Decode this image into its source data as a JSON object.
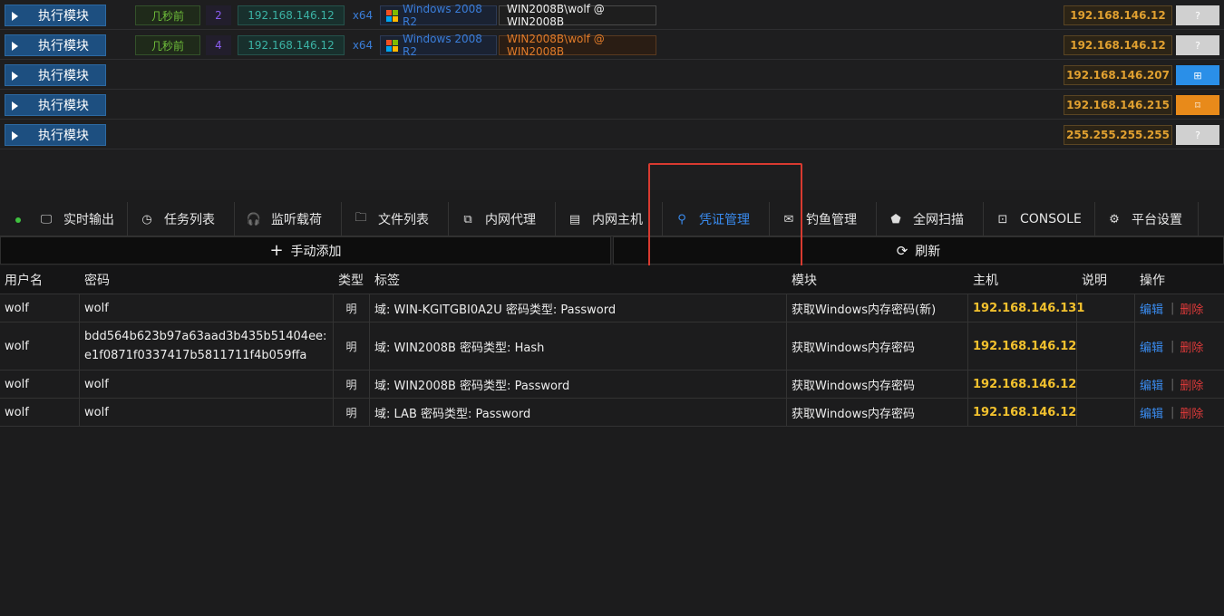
{
  "sessions": [
    {
      "exec": "执行模块",
      "time": "几秒前",
      "num": "2",
      "ip": "192.168.146.12",
      "arch": "x64",
      "os": "Windows 2008 R2",
      "user": "WIN2008B\\wolf @ WIN2008B",
      "user_style": "normal",
      "host_ip": "192.168.146.12",
      "icon": "?",
      "icon_style": "gray",
      "has_details": true
    },
    {
      "exec": "执行模块",
      "time": "几秒前",
      "num": "4",
      "ip": "192.168.146.12",
      "arch": "x64",
      "os": "Windows 2008 R2",
      "user": "WIN2008B\\wolf @ WIN2008B",
      "user_style": "orange",
      "host_ip": "192.168.146.12",
      "icon": "?",
      "icon_style": "gray",
      "has_details": true
    },
    {
      "exec": "执行模块",
      "host_ip": "192.168.146.207",
      "icon": "⊞",
      "icon_style": "blue",
      "has_details": false
    },
    {
      "exec": "执行模块",
      "host_ip": "192.168.146.215",
      "icon": "⌑",
      "icon_style": "orange",
      "has_details": false
    },
    {
      "exec": "执行模块",
      "host_ip": "255.255.255.255",
      "icon": "?",
      "icon_style": "gray",
      "has_details": false
    }
  ],
  "tabs": [
    {
      "label": "实时输出",
      "icon": "🖵",
      "name": "tab-realtime-output"
    },
    {
      "label": "任务列表",
      "icon": "◷",
      "name": "tab-task-list"
    },
    {
      "label": "监听载荷",
      "icon": "🎧",
      "name": "tab-listener-payload"
    },
    {
      "label": "文件列表",
      "icon": "🗀",
      "name": "tab-file-list"
    },
    {
      "label": "内网代理",
      "icon": "⧉",
      "name": "tab-intranet-proxy"
    },
    {
      "label": "内网主机",
      "icon": "▤",
      "name": "tab-intranet-host"
    },
    {
      "label": "凭证管理",
      "icon": "⚲",
      "name": "tab-credential-management"
    },
    {
      "label": "钓鱼管理",
      "icon": "✉",
      "name": "tab-phishing-management"
    },
    {
      "label": "全网扫描",
      "icon": "⬟",
      "name": "tab-network-scan"
    },
    {
      "label": "CONSOLE",
      "icon": "⊡",
      "name": "tab-console"
    },
    {
      "label": "平台设置",
      "icon": "⚙",
      "name": "tab-platform-settings"
    }
  ],
  "actions": {
    "add_label": "手动添加",
    "refresh_label": "刷新"
  },
  "table": {
    "headers": {
      "username": "用户名",
      "password": "密码",
      "type": "类型",
      "tag": "标签",
      "module": "模块",
      "host": "主机",
      "note": "说明",
      "ops": "操作"
    },
    "rows": [
      {
        "username": "wolf",
        "password": "wolf",
        "type": "明",
        "tag": "域: WIN-KGITGBI0A2U 密码类型: Password",
        "module": "获取Windows内存密码(新)",
        "host": "192.168.146.131",
        "note": "",
        "edit": "编辑",
        "sep": "|",
        "delete": "删除"
      },
      {
        "username": "wolf",
        "password": "bdd564b623b97a63aad3b435b51404ee:e1f0871f0337417b5811711f4b059ffa",
        "type": "明",
        "tag": "域: WIN2008B 密码类型: Hash",
        "module": "获取Windows内存密码",
        "host": "192.168.146.12",
        "note": "",
        "edit": "编辑",
        "sep": "|",
        "delete": "删除"
      },
      {
        "username": "wolf",
        "password": "wolf",
        "type": "明",
        "tag": "域: WIN2008B 密码类型: Password",
        "module": "获取Windows内存密码",
        "host": "192.168.146.12",
        "note": "",
        "edit": "编辑",
        "sep": "|",
        "delete": "删除"
      },
      {
        "username": "wolf",
        "password": "wolf",
        "type": "明",
        "tag": "域: LAB 密码类型: Password",
        "module": "获取Windows内存密码",
        "host": "192.168.146.12",
        "note": "",
        "edit": "编辑",
        "sep": "|",
        "delete": "删除"
      }
    ]
  }
}
